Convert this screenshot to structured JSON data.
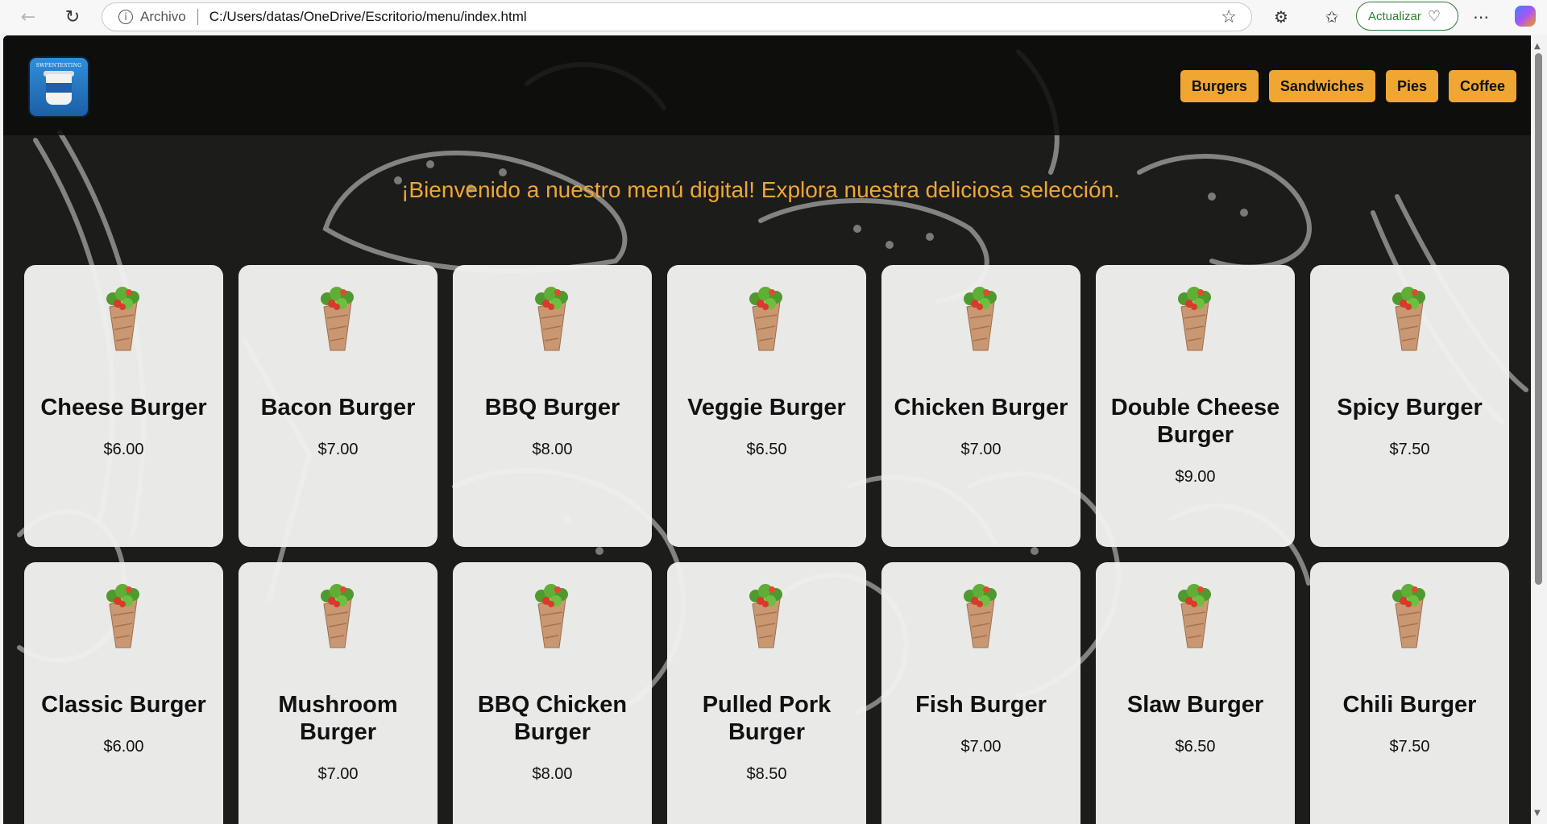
{
  "browser": {
    "site_label": "Archivo",
    "url": "C:/Users/datas/OneDrive/Escritorio/menu/index.html",
    "update_label": "Actualizar",
    "icons": [
      "back-arrow-icon",
      "refresh-icon",
      "info-icon",
      "star-icon",
      "extensions-icon",
      "favorites-icon",
      "more-icon",
      "copilot-icon"
    ]
  },
  "logo": {
    "text": "SWPENTESTING"
  },
  "nav": {
    "items": [
      {
        "label": "Burgers"
      },
      {
        "label": "Sandwiches"
      },
      {
        "label": "Pies"
      },
      {
        "label": "Coffee"
      }
    ]
  },
  "welcome_text": "¡Bienvenido a nuestro menú digital! Explora nuestra deliciosa selección.",
  "menu_items": [
    {
      "name": "Cheese Burger",
      "price": "$6.00"
    },
    {
      "name": "Bacon Burger",
      "price": "$7.00"
    },
    {
      "name": "BBQ Burger",
      "price": "$8.00"
    },
    {
      "name": "Veggie Burger",
      "price": "$6.50"
    },
    {
      "name": "Chicken Burger",
      "price": "$7.00"
    },
    {
      "name": "Double Cheese Burger",
      "price": "$9.00"
    },
    {
      "name": "Spicy Burger",
      "price": "$7.50"
    },
    {
      "name": "Classic Burger",
      "price": "$6.00"
    },
    {
      "name": "Mushroom Burger",
      "price": "$7.00"
    },
    {
      "name": "BBQ Chicken Burger",
      "price": "$8.00"
    },
    {
      "name": "Pulled Pork Burger",
      "price": "$8.50"
    },
    {
      "name": "Fish Burger",
      "price": "$7.00"
    },
    {
      "name": "Slaw Burger",
      "price": "$6.50"
    },
    {
      "name": "Chili Burger",
      "price": "$7.50"
    }
  ],
  "colors": {
    "accent": "#f0a632",
    "background": "#1c1c1a",
    "card": "#f1f1ef"
  }
}
